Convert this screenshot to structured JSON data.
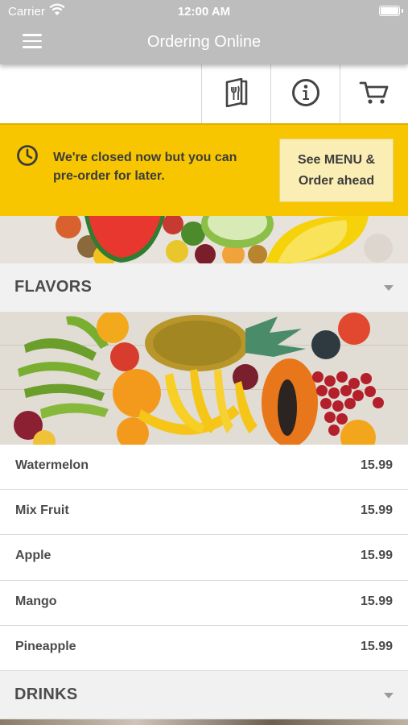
{
  "status_bar": {
    "carrier": "Carrier",
    "time": "12:00 AM"
  },
  "nav": {
    "title": "Ordering Online"
  },
  "toolbar": {
    "icons": [
      "menu-book-icon",
      "info-icon",
      "cart-icon"
    ]
  },
  "banner": {
    "message": "We're closed now but you can pre-order for later.",
    "button_line1": "See MENU &",
    "button_line2": "Order ahead"
  },
  "sections": {
    "flavors": {
      "title": "FLAVORS"
    },
    "drinks": {
      "title": "DRINKS"
    }
  },
  "items": [
    {
      "name": "Watermelon",
      "price": "15.99"
    },
    {
      "name": "Mix Fruit",
      "price": "15.99"
    },
    {
      "name": "Apple",
      "price": "15.99"
    },
    {
      "name": "Mango",
      "price": "15.99"
    },
    {
      "name": "Pineapple",
      "price": "15.99"
    }
  ],
  "colors": {
    "accent": "#f7c600",
    "navbar": "#bdbdbd",
    "button_bg": "#fbeeb4"
  }
}
